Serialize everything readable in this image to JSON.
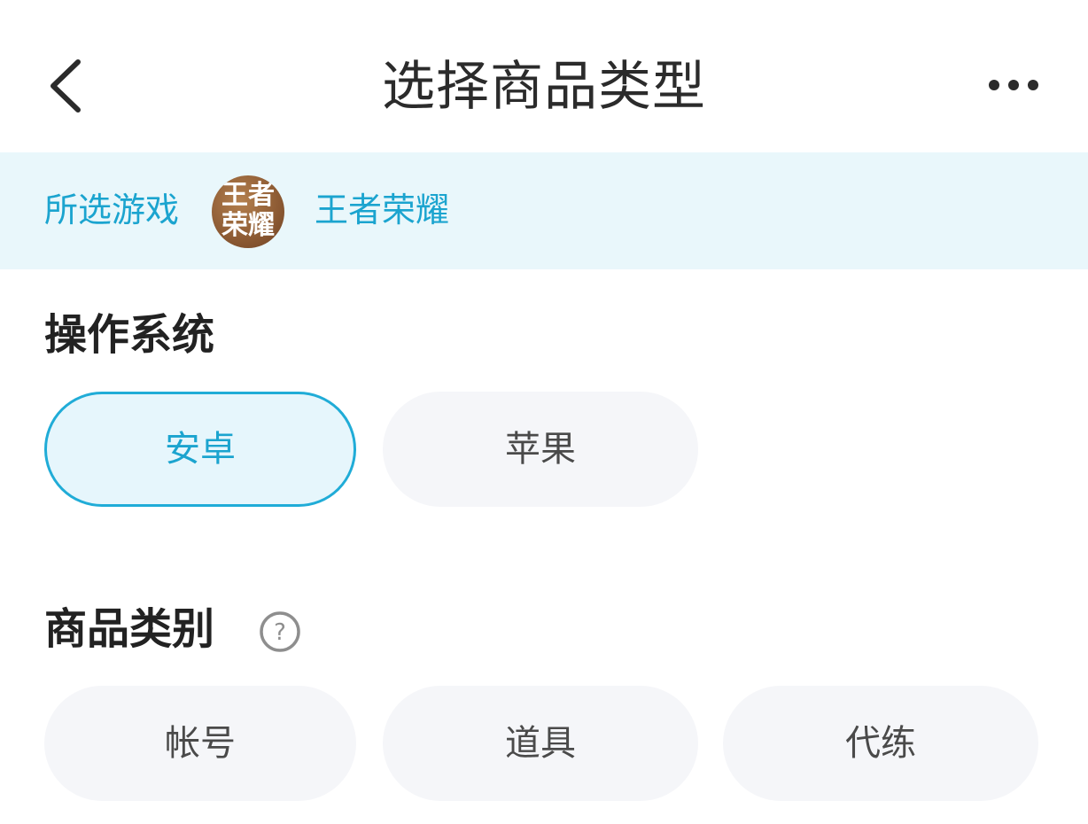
{
  "header": {
    "title": "选择商品类型",
    "back_icon": "chevron-left-icon",
    "more_icon": "more-horizontal-icon"
  },
  "selected_game": {
    "label": "所选游戏",
    "logo_text": "王者荣耀",
    "name": "王者荣耀"
  },
  "os_section": {
    "title": "操作系统",
    "options": [
      {
        "label": "安卓",
        "selected": true
      },
      {
        "label": "苹果",
        "selected": false
      }
    ]
  },
  "category_section": {
    "title": "商品类别",
    "help_icon": "question-circle-icon",
    "options": [
      {
        "label": "帐号",
        "selected": false
      },
      {
        "label": "道具",
        "selected": false
      },
      {
        "label": "代练",
        "selected": false
      }
    ]
  },
  "colors": {
    "accent": "#1ba4cf",
    "selected_border": "#20acd7",
    "selected_bg": "#e6f6fc",
    "pill_bg": "#f5f6f9",
    "game_bar_bg": "#e9f7fb"
  }
}
